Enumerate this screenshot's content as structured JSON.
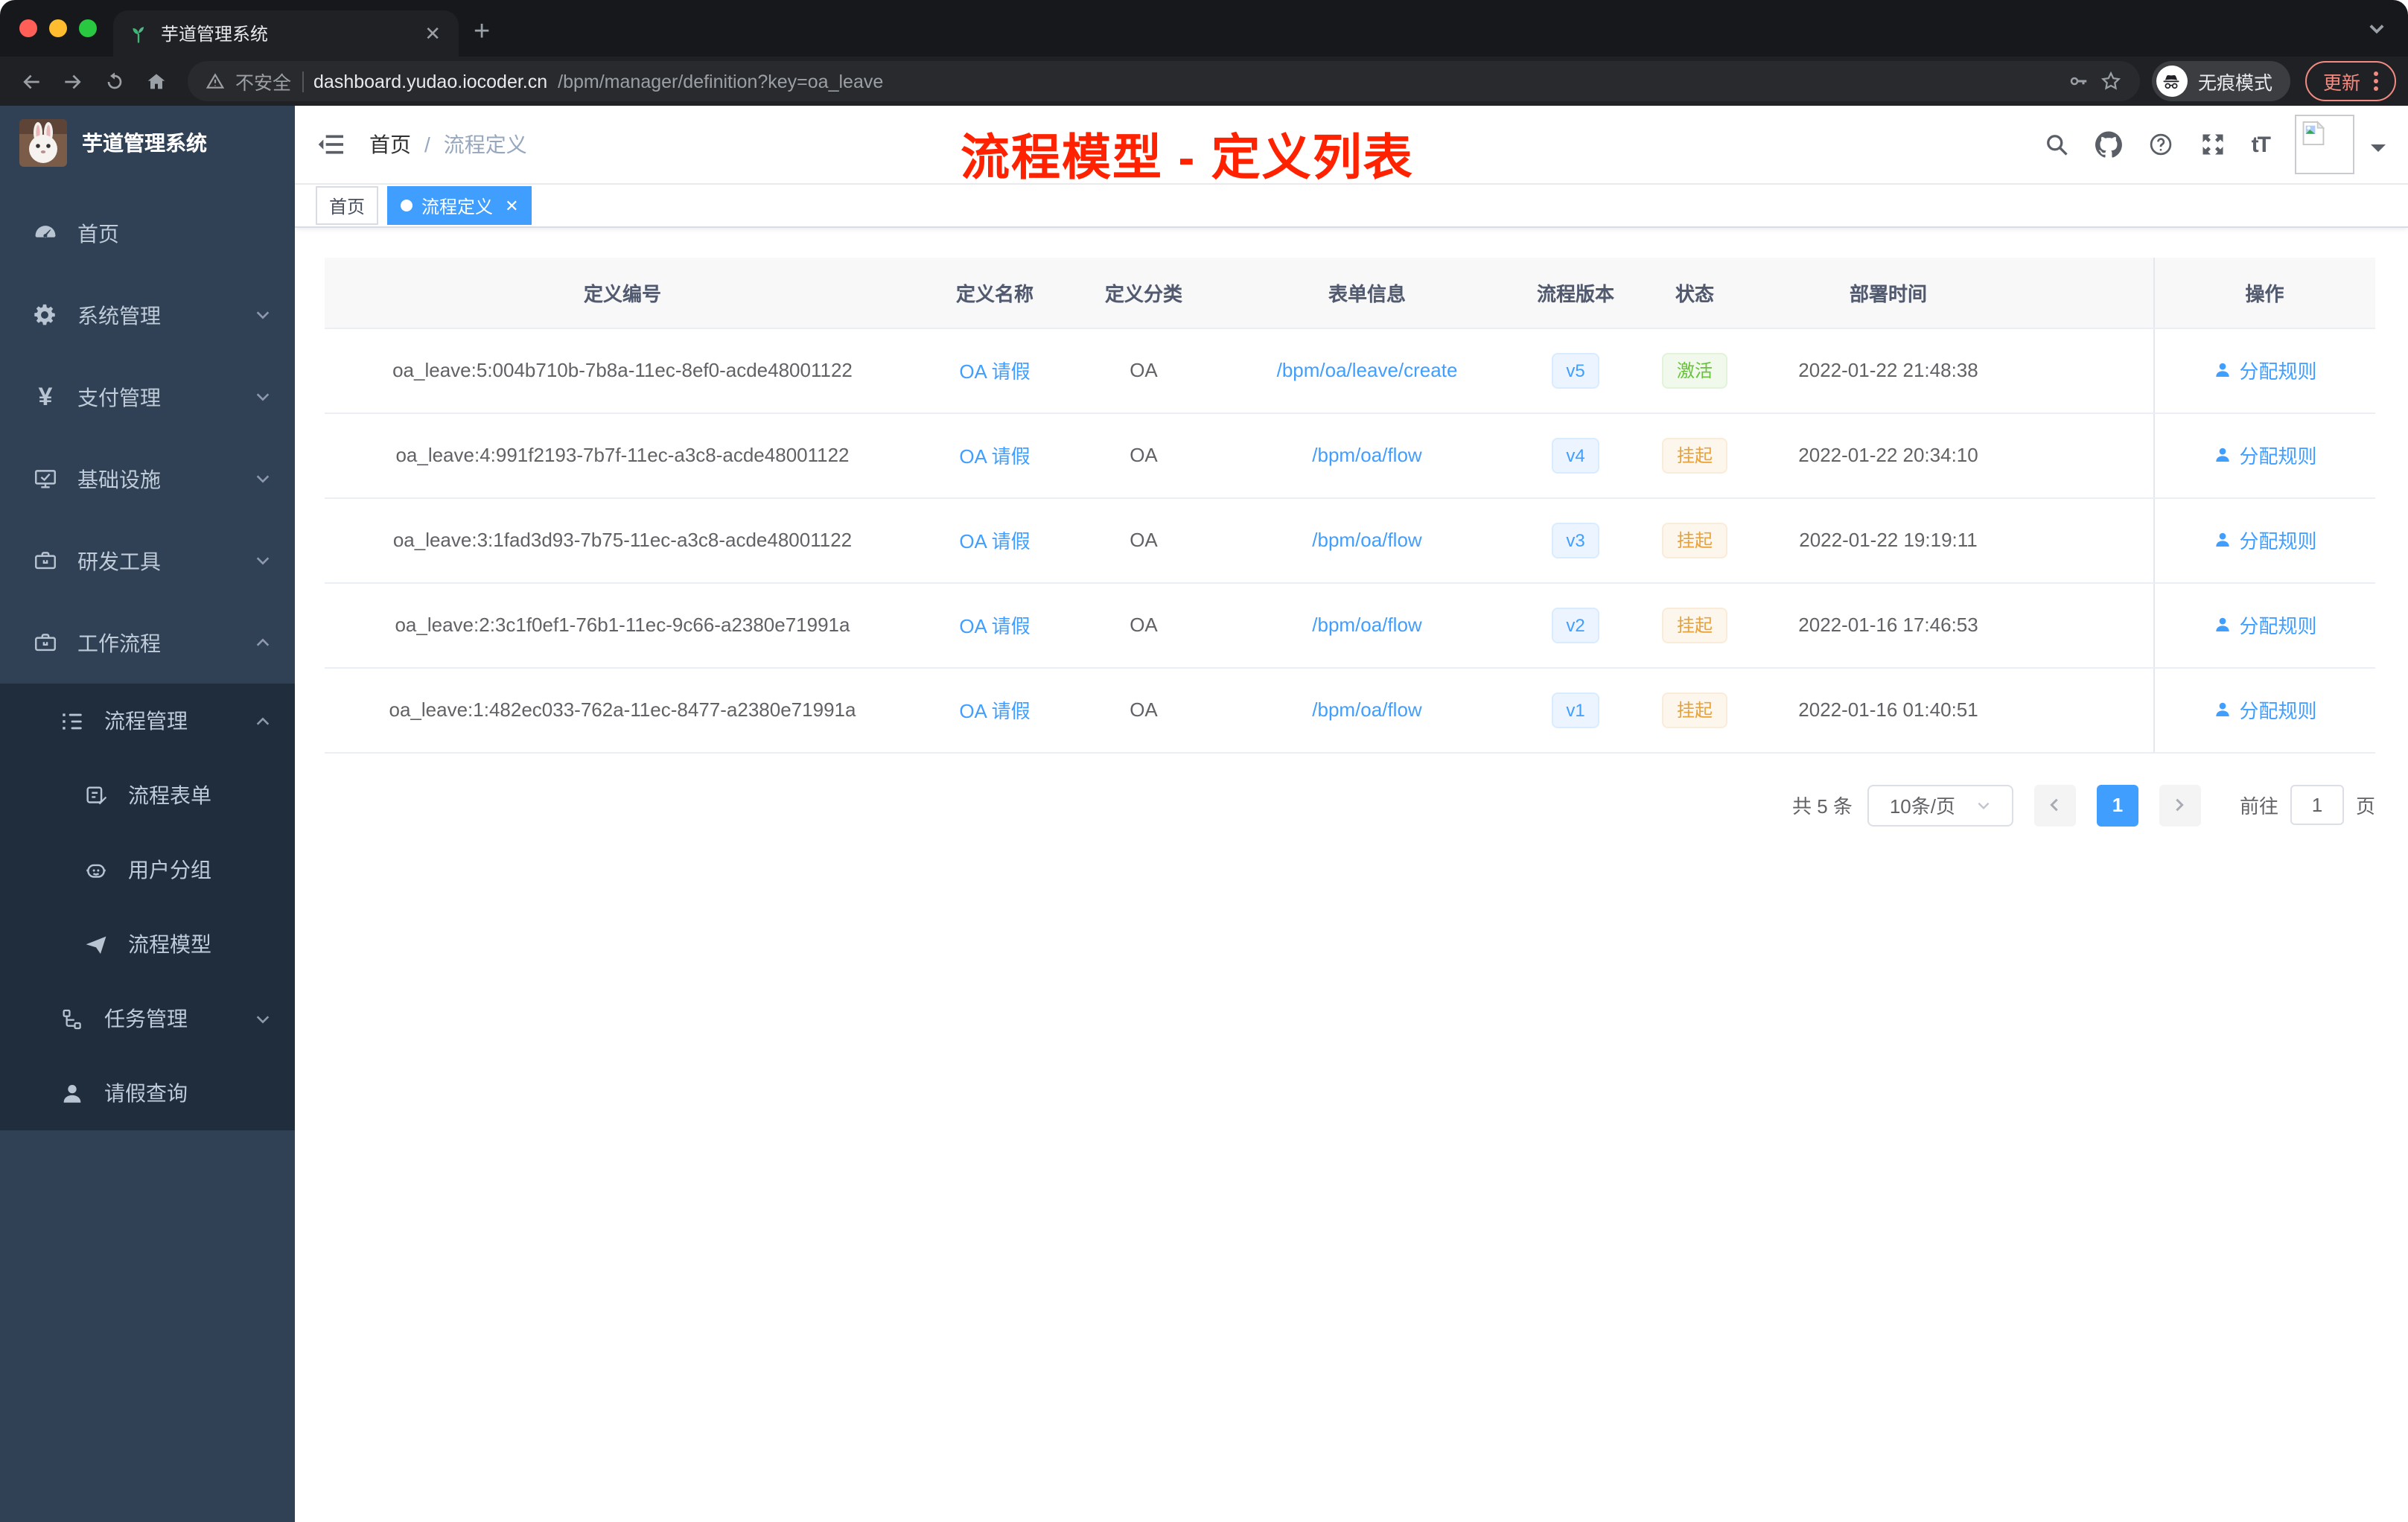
{
  "browser": {
    "tab_title": "芋道管理系统",
    "new_tab_glyph": "+",
    "close_glyph": "✕",
    "security_label": "不安全",
    "url_host": "dashboard.yudao.iocoder.cn",
    "url_path": "/bpm/manager/definition?key=oa_leave",
    "incognito_label": "无痕模式",
    "update_label": "更新"
  },
  "sidebar": {
    "logo_title": "芋道管理系统",
    "items": [
      {
        "label": "首页",
        "icon": "dashboard-icon"
      },
      {
        "label": "系统管理",
        "icon": "gear-icon",
        "state": "collapsed"
      },
      {
        "label": "支付管理",
        "icon": "yen-icon",
        "state": "collapsed"
      },
      {
        "label": "基础设施",
        "icon": "monitor-icon",
        "state": "collapsed"
      },
      {
        "label": "研发工具",
        "icon": "toolbox-icon",
        "state": "collapsed"
      },
      {
        "label": "工作流程",
        "icon": "briefcase-icon",
        "state": "expanded"
      },
      {
        "label": "流程管理",
        "icon": "tree-table-icon",
        "state": "expanded"
      },
      {
        "label": "流程表单",
        "icon": "form-edit-icon"
      },
      {
        "label": "用户分组",
        "icon": "robot-icon"
      },
      {
        "label": "流程模型",
        "icon": "paper-plane-icon"
      },
      {
        "label": "任务管理",
        "icon": "org-tree-icon",
        "state": "collapsed"
      },
      {
        "label": "请假查询",
        "icon": "user-icon"
      }
    ]
  },
  "header": {
    "breadcrumb": {
      "home": "首页",
      "separator": "/",
      "current": "流程定义"
    },
    "font_size_glyph": "tT"
  },
  "annotation": {
    "text": "流程模型 - 定义列表",
    "color": "#ff2200"
  },
  "tags": [
    {
      "label": "首页",
      "active": false
    },
    {
      "label": "流程定义",
      "active": true,
      "close_glyph": "✕"
    }
  ],
  "table": {
    "columns": [
      "定义编号",
      "定义名称",
      "定义分类",
      "表单信息",
      "流程版本",
      "状态",
      "部署时间",
      "操作"
    ],
    "rows": [
      {
        "id": "oa_leave:5:004b710b-7b8a-11ec-8ef0-acde48001122",
        "name": "OA 请假",
        "category": "OA",
        "form": "/bpm/oa/leave/create",
        "version": "v5",
        "status": "激活",
        "status_type": "success",
        "deploy_time": "2022-01-22 21:48:38",
        "action": "分配规则"
      },
      {
        "id": "oa_leave:4:991f2193-7b7f-11ec-a3c8-acde48001122",
        "name": "OA 请假",
        "category": "OA",
        "form": "/bpm/oa/flow",
        "version": "v4",
        "status": "挂起",
        "status_type": "warning",
        "deploy_time": "2022-01-22 20:34:10",
        "action": "分配规则"
      },
      {
        "id": "oa_leave:3:1fad3d93-7b75-11ec-a3c8-acde48001122",
        "name": "OA 请假",
        "category": "OA",
        "form": "/bpm/oa/flow",
        "version": "v3",
        "status": "挂起",
        "status_type": "warning",
        "deploy_time": "2022-01-22 19:19:11",
        "action": "分配规则"
      },
      {
        "id": "oa_leave:2:3c1f0ef1-76b1-11ec-9c66-a2380e71991a",
        "name": "OA 请假",
        "category": "OA",
        "form": "/bpm/oa/flow",
        "version": "v2",
        "status": "挂起",
        "status_type": "warning",
        "deploy_time": "2022-01-16 17:46:53",
        "action": "分配规则"
      },
      {
        "id": "oa_leave:1:482ec033-762a-11ec-8477-a2380e71991a",
        "name": "OA 请假",
        "category": "OA",
        "form": "/bpm/oa/flow",
        "version": "v1",
        "status": "挂起",
        "status_type": "warning",
        "deploy_time": "2022-01-16 01:40:51",
        "action": "分配规则"
      }
    ]
  },
  "pagination": {
    "total": "共 5 条",
    "page_size": "10条/页",
    "current_page": "1",
    "goto_label": "前往",
    "goto_value": "1",
    "page_unit": "页"
  },
  "colors": {
    "accent": "#409eff",
    "success": "#67c23a",
    "warning": "#e6a23c",
    "sidebar_bg": "#304156",
    "submenu_bg": "#1f2d3d",
    "annotation_red": "#ff2200",
    "update_red": "#f28b82"
  }
}
